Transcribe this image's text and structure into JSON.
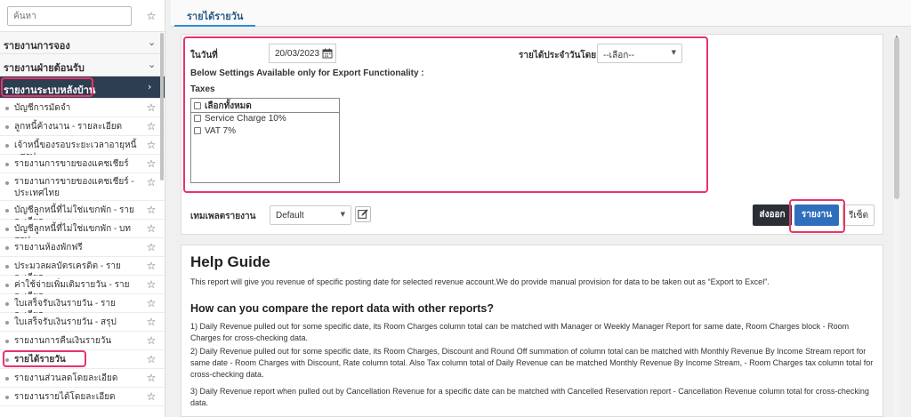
{
  "sidebar": {
    "search_placeholder": "ค้นหา",
    "groups": [
      {
        "label": "รายงานการจอง"
      },
      {
        "label": "รายงานฝ่ายต้อนรับ"
      },
      {
        "label": "รายงานระบบหลังบ้าน"
      }
    ],
    "items": [
      {
        "label": "บัญชีการมัดจำ"
      },
      {
        "label": "ลูกหนี้ค้างนาน - รายละเอียด"
      },
      {
        "label": "เจ้าหนี้ของรอบระยะเวลาอายุหนี้ - สรุป"
      },
      {
        "label": "รายงานการขายของแคชเชียร์"
      },
      {
        "label": "รายงานการขายของแคชเชียร์ - ประเทศไทย"
      },
      {
        "label": "บัญชีลูกหนี้ที่ไม่ใช่แขกพัก - รายละเอียด"
      },
      {
        "label": "บัญชีลูกหนี้ที่ไม่ใช่แขกพัก - บทสรุป"
      },
      {
        "label": "รายงานห้องพักฟรี"
      },
      {
        "label": "ประมวลผลบัตรเครดิต - รายละเอียด"
      },
      {
        "label": "ค่าใช้จ่ายเพิ่มเติมรายวัน - รายละเอียด"
      },
      {
        "label": "ใบเสร็จรับเงินรายวัน - รายละเอียด"
      },
      {
        "label": "ใบเสร็จรับเงินรายวัน - สรุป"
      },
      {
        "label": "รายงานการคืนเงินรายวัน"
      },
      {
        "label": "รายได้รายวัน"
      },
      {
        "label": "รายงานส่วนลดโดยละเอียด"
      },
      {
        "label": "รายงานรายได้โดยละเอียด"
      }
    ]
  },
  "tab": {
    "label": "รายได้รายวัน"
  },
  "form": {
    "date_label": "ในวันที่",
    "date_value": "20/03/2023",
    "revenue_by_label": "รายได้ประจำวันโดย",
    "revenue_by_value": "--เลือก--",
    "export_note": "Below Settings Available only for Export Functionality :",
    "taxes_label": "Taxes",
    "tax_select_all": "เลือกทั้งหมด",
    "tax_options": [
      "Service Charge 10%",
      "VAT 7%"
    ],
    "template_label": "เทมเพลตรายงาน",
    "template_value": "Default"
  },
  "buttons": {
    "export": "ส่งออก",
    "report": "รายงาน",
    "reset": "รีเซ็ต"
  },
  "help": {
    "title": "Help Guide",
    "intro": "This report will give you revenue of specific posting date for selected revenue account.We do provide manual provision for data to be taken out as “Export to Excel”.",
    "compare_title": "How can you compare the report data with other reports?",
    "points": [
      "1) Daily Revenue pulled out for some specific date, its Room Charges column total can be matched with Manager or Weekly Manager Report for same date, Room Charges block - Room Charges for cross-checking data.",
      "2) Daily Revenue pulled out for some specific date, its Room Charges, Discount and Round Off summation of column total can be matched with Monthly Revenue By Income Stream report for same date - Room Charges with Discount, Rate column total. Also Tax column total of Daily Revenue can be matched Monthly Revenue By Income Stream, - Room Charges tax column total for cross-checking data.",
      "3) Daily Revenue report when pulled out by Cancellation Revenue for a specific date can be matched with Cancelled Reservation report - Cancellation Revenue column total for cross-checking data."
    ]
  },
  "colors": {
    "highlight": "#e8336b",
    "active_group": "#2d3e50",
    "primary": "#2f6ebd",
    "tab_accent": "#2b8cd6"
  },
  "icons": [
    "star-icon",
    "chevron-down-icon",
    "chevron-right-icon",
    "calendar-icon",
    "edit-icon",
    "caret-down-icon"
  ]
}
